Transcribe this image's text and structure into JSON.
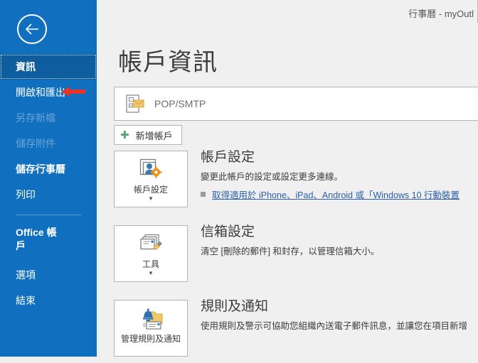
{
  "window": {
    "title": "行事曆 - myOutl"
  },
  "sidebar": {
    "back_label": "back-arrow",
    "items": [
      {
        "label": "資訊",
        "state": "selected"
      },
      {
        "label": "開啟和匯出",
        "state": "normal"
      },
      {
        "label": "另存新檔",
        "state": "disabled"
      },
      {
        "label": "儲存附件",
        "state": "disabled"
      },
      {
        "label": "儲存行事曆",
        "state": "bold"
      },
      {
        "label": "列印",
        "state": "normal"
      },
      {
        "label": "Office 帳戶",
        "state": "bold"
      },
      {
        "label": "選項",
        "state": "normal"
      },
      {
        "label": "結束",
        "state": "normal"
      }
    ],
    "annotation_color": "#e8352b"
  },
  "main": {
    "page_title": "帳戶資訊",
    "account_selector": {
      "label": "POP/SMTP",
      "icon": "mail-account-icon"
    },
    "add_account_button": {
      "label": "新增帳戶",
      "plus_color": "#56a379"
    },
    "sections": [
      {
        "button_label": "帳戶設定",
        "button_icon": "account-settings-icon",
        "has_caret": true,
        "heading": "帳戶設定",
        "description": "變更此帳戶的設定或設定更多連線。",
        "link": "取得適用於 iPhone、iPad、Android 或「Windows 10 行動裝置",
        "link_color": "#2a5fa8"
      },
      {
        "button_label": "工具",
        "button_icon": "mailbox-cleanup-icon",
        "has_caret": true,
        "heading": "信箱設定",
        "description": "清空 [刪除的郵件] 和封存，以管理信箱大小。",
        "link": "",
        "link_color": "#2a5fa8"
      },
      {
        "button_label": "管理規則及通知",
        "button_icon": "rules-alerts-icon",
        "has_caret": false,
        "heading": "規則及通知",
        "description": "使用規則及警示可協助您組織內送電子郵件訊息，並讓您在項目新增",
        "link": "",
        "link_color": "#2a5fa8"
      }
    ]
  },
  "colors": {
    "rail": "#1070bf",
    "rail_selected": "#0d5d9f",
    "content_bg": "#f0f0f0"
  }
}
